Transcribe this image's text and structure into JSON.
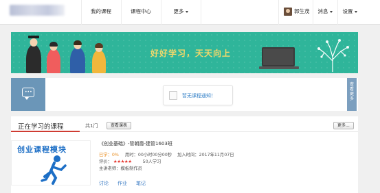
{
  "nav": {
    "items": [
      {
        "label": "我的课程"
      },
      {
        "label": "课程中心"
      },
      {
        "label": "更多"
      }
    ],
    "user_name": "郭生茂",
    "messages_label": "消息",
    "settings_label": "设置"
  },
  "banner": {
    "slogan": "好好学习，天天向上",
    "colors": {
      "background": "#2fb59a",
      "slogan": "#f2d86b"
    }
  },
  "notice": {
    "text": "暂无课程通知！",
    "more_tab": "查看更多"
  },
  "learning": {
    "title": "正在学习的课程",
    "count": "共1门",
    "view_button": "查看课表",
    "more_button": "更多..."
  },
  "course": {
    "thumbnail_title": "创业课程模块",
    "title": "《创业基础》-管朝霞-建管1603班",
    "progress_label": "已学：",
    "progress_value": "0%",
    "time_label": "用时：",
    "time_value": "00小时00分00秒",
    "join_label": "加入时间：",
    "join_value": "2017年11月07日",
    "rating_label": "评价：",
    "rating_value": 4.5,
    "learners": "50人学习",
    "teacher_label": "主讲老师：",
    "teacher_name": "模板制作员",
    "links": [
      {
        "label": "讨论"
      },
      {
        "label": "作业"
      },
      {
        "label": "笔记"
      }
    ]
  }
}
